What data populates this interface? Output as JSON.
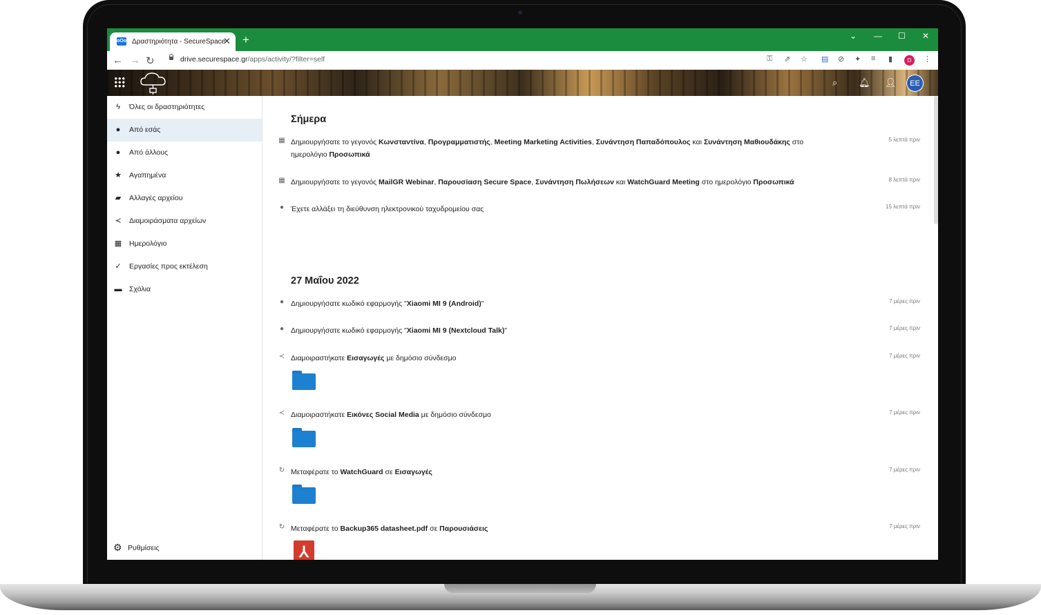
{
  "browser": {
    "tab_title": "Δραστηριότητα - SecureSpace",
    "new_tab": "+",
    "url_host": "drive.securespace.gr",
    "url_path": "/apps/activity/?filter=self",
    "profile_initial": "D"
  },
  "header": {
    "avatar_initials": "ΕΕ"
  },
  "sidebar": {
    "items": [
      {
        "label": "Όλες οι δραστηριότητες",
        "icon": "lightning-icon"
      },
      {
        "label": "Από εσάς",
        "icon": "user-icon"
      },
      {
        "label": "Από άλλους",
        "icon": "users-icon"
      },
      {
        "label": "Αγαπημένα",
        "icon": "star-icon"
      },
      {
        "label": "Αλλαγές αρχείου",
        "icon": "folder-icon"
      },
      {
        "label": "Διαμοιράσματα αρχείων",
        "icon": "share-icon"
      },
      {
        "label": "Ημερολόγιο",
        "icon": "calendar-icon"
      },
      {
        "label": "Εργασίες προς εκτέλεση",
        "icon": "check-icon"
      },
      {
        "label": "Σχόλια",
        "icon": "comment-icon"
      }
    ],
    "settings_label": "Ρυθμίσεις"
  },
  "stream": {
    "today_heading": "Σήμερα",
    "date_heading": "27 Μαΐου 2022",
    "today": [
      {
        "time": "5 λεπτά πριν",
        "icon": "calendar-icon"
      },
      {
        "time": "8 λεπτά πριν",
        "icon": "calendar-icon"
      },
      {
        "text": "Έχετε αλλάξει τη διεύθυνση ηλεκτρονικού ταχυδρομείου σας",
        "time": "15 λεπτά πριν",
        "icon": "user-icon"
      }
    ],
    "older": [
      {
        "time": "7 μέρες πριν",
        "icon": "user-icon"
      },
      {
        "time": "7 μέρες πριν",
        "icon": "user-icon"
      },
      {
        "time": "7 μέρες πριν",
        "icon": "share-icon"
      },
      {
        "time": "7 μέρες πριν",
        "icon": "share-icon"
      },
      {
        "time": "7 μέρες πριν",
        "icon": "move-icon"
      },
      {
        "time": "7 μέρες πριν",
        "icon": "move-icon"
      }
    ],
    "t": {
      "a1": "Δημιουργήσατε το γεγονός ",
      "a1_b1": "Κωνσταντίνα",
      "a1_b2": "Προγραμματιστής",
      "a1_b3": "Meeting Marketing Activities",
      "a1_b4": "Συνάντηση Παπαδόπουλος",
      "a1_and": " και ",
      "a1_b5": "Συνάντηση Μαθιουδάκης",
      "a1_tail": " στο ημερολόγιο ",
      "a1_b6": "Προσωπικά",
      "a2": "Δημιουργήσατε το γεγονός ",
      "a2_b1": "MailGR Webinar",
      "a2_b2": "Παρουσίαση Secure Space",
      "a2_b3": "Συνάντηση Πωλήσεων",
      "a2_and": " και ",
      "a2_b4": "WatchGuard Meeting",
      "a2_tail": " στο ημερολόγιο ",
      "a2_b5": "Προσωπικά",
      "b1": "Δημιουργήσατε κωδικό εφαρμογής \"",
      "b1_b": "Xiaomi MI 9 (Android)",
      "b2": "Δημιουργήσατε κωδικό εφαρμογής \"",
      "b2_b": "Xiaomi MI 9 (Nextcloud Talk)",
      "b3": "Διαμοιραστήκατε ",
      "b3_b": "Εισαγωγές",
      "b3_tail": " με δημόσιο σύνδεσμο",
      "b4": "Διαμοιραστήκατε ",
      "b4_b": "Εικόνες Social Media",
      "b4_tail": " με δημόσιο σύνδεσμο",
      "b5": "Μεταφέρατε το ",
      "b5_b1": "WatchGuard",
      "b5_mid": " σε ",
      "b5_b2": "Εισαγωγές",
      "b6": "Μεταφέρατε το ",
      "b6_b1": "Backup365 datasheet.pdf",
      "b6_mid": " σε ",
      "b6_b2": "Παρουσιάσεις",
      "quote": "\"",
      "comma": ", "
    }
  }
}
